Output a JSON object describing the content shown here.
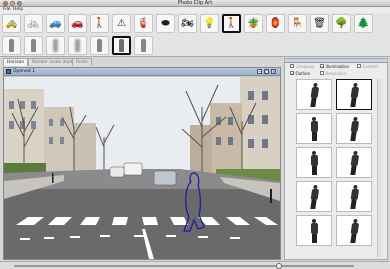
{
  "window": {
    "title": "Photo Clip Art"
  },
  "menu": {
    "items": [
      {
        "id": "file",
        "label": "File"
      },
      {
        "id": "help",
        "label": "Help"
      }
    ]
  },
  "toolbar": {
    "categories": [
      {
        "id": "car-yellow",
        "icon": "car-icon",
        "glyph": "🚕"
      },
      {
        "id": "bicycle",
        "icon": "bicycle-icon",
        "glyph": "🚲"
      },
      {
        "id": "car-blue",
        "icon": "car-icon",
        "glyph": "🚙"
      },
      {
        "id": "car-red",
        "icon": "car-icon",
        "glyph": "🚗"
      },
      {
        "id": "person",
        "icon": "person-icon",
        "glyph": "🚶"
      },
      {
        "id": "cone",
        "icon": "traffic-cone-icon",
        "glyph": "⚠"
      },
      {
        "id": "hydrant",
        "icon": "fire-hydrant-icon",
        "glyph": "🧯"
      },
      {
        "id": "rock",
        "icon": "rock-icon",
        "glyph": "⬬"
      },
      {
        "id": "motorcycle",
        "icon": "motorcycle-icon",
        "glyph": "🏍"
      },
      {
        "id": "streetlight",
        "icon": "street-light-icon",
        "glyph": "💡"
      },
      {
        "id": "walker",
        "icon": "walking-person-icon",
        "glyph": "🚶",
        "selected": true
      },
      {
        "id": "pot",
        "icon": "pot-icon",
        "glyph": "🪴"
      },
      {
        "id": "lamp",
        "icon": "lamp-icon",
        "glyph": "🏮"
      },
      {
        "id": "table",
        "icon": "table-icon",
        "glyph": "🪑"
      },
      {
        "id": "trashcan",
        "icon": "trash-can-icon",
        "glyph": "🗑"
      },
      {
        "id": "tree",
        "icon": "tree-icon",
        "glyph": "🌳"
      },
      {
        "id": "tree-2",
        "icon": "tree-icon",
        "glyph": "🌲"
      }
    ],
    "depth_variants": [
      {
        "id": "v1",
        "icon": "silhouette-icon"
      },
      {
        "id": "v2",
        "icon": "silhouette-icon"
      },
      {
        "id": "v3",
        "icon": "silhouette-icon"
      },
      {
        "id": "v4",
        "icon": "silhouette-icon"
      },
      {
        "id": "v5",
        "icon": "silhouette-icon"
      },
      {
        "id": "v6",
        "icon": "silhouette-icon",
        "selected": true
      },
      {
        "id": "v7",
        "icon": "silhouette-icon"
      }
    ]
  },
  "tabs": [
    {
      "id": "horizon",
      "label": "Horizon",
      "active": true
    },
    {
      "id": "render-scale-depth",
      "label": "Render scale depth",
      "active": false
    },
    {
      "id": "undo",
      "label": "Undo",
      "active": false
    }
  ],
  "document": {
    "title": "Opened 1",
    "controls": [
      "minimize",
      "maximize",
      "close"
    ]
  },
  "right_panel": {
    "options": [
      {
        "id": "lineaway",
        "label": "Lineaway",
        "checked": false,
        "enabled": false
      },
      {
        "id": "illumination",
        "label": "Illumination",
        "checked": true,
        "enabled": true
      },
      {
        "id": "context",
        "label": "Context",
        "checked": false,
        "enabled": false
      },
      {
        "id": "outline",
        "label": "Outline",
        "checked": true,
        "enabled": true
      },
      {
        "id": "resolution",
        "label": "Resolution",
        "checked": false,
        "enabled": false
      }
    ],
    "results": [
      {
        "id": "r1",
        "icon": "person-walking-icon",
        "selected": false
      },
      {
        "id": "r2",
        "icon": "person-walking-icon",
        "selected": true
      },
      {
        "id": "r3",
        "icon": "person-standing-icon",
        "selected": false
      },
      {
        "id": "r4",
        "icon": "person-walking-icon",
        "selected": false
      },
      {
        "id": "r5",
        "icon": "person-standing-icon",
        "selected": false
      },
      {
        "id": "r6",
        "icon": "person-walking-icon",
        "selected": false
      },
      {
        "id": "r7",
        "icon": "person-walking-icon",
        "selected": false
      },
      {
        "id": "r8",
        "icon": "person-walking-icon",
        "selected": false
      },
      {
        "id": "r9",
        "icon": "person-standing-icon",
        "selected": false
      },
      {
        "id": "r10",
        "icon": "person-walking-icon",
        "selected": false
      }
    ]
  },
  "status": {
    "zoom_fraction": 0.78
  },
  "colors": {
    "accent": "#1a1aa8",
    "selection_border": "#111111",
    "doc_header": "#9ab0cc"
  }
}
